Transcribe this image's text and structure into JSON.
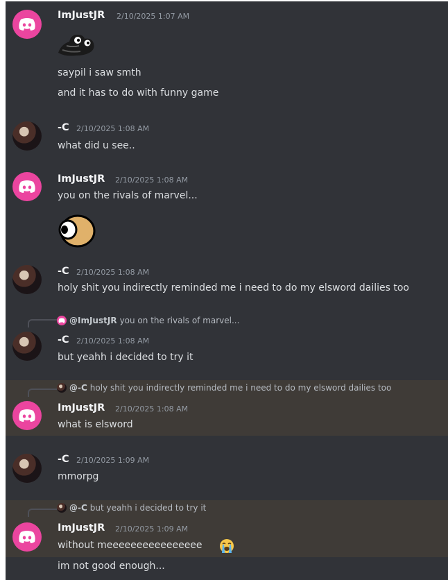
{
  "users": {
    "jr": "ImJustJR",
    "c": "-C"
  },
  "colors": {
    "background": "#313338",
    "highlight": "#3f3b37",
    "discord_pink": "#eb459f",
    "username": "#f2f3f5",
    "text": "#dbdee1",
    "timestamp": "#949ba4"
  },
  "icons": {
    "default_avatar": "discord-logo-icon",
    "character_avatar": "anime-character-avatar",
    "loud_crying_emoji": "loudly-crying-face-emoji"
  },
  "messages": [
    {
      "author": "ImJustJR",
      "timestamp": "2/10/2025 1:07 AM",
      "lines": [
        "saypil i saw smth",
        "and it has to do with funny game"
      ]
    },
    {
      "author": "-C",
      "timestamp": "2/10/2025 1:08 AM",
      "lines": [
        "what did u see.."
      ]
    },
    {
      "author": "ImJustJR",
      "timestamp": "2/10/2025 1:08 AM",
      "lines": [
        "you on the rivals of marvel..."
      ]
    },
    {
      "author": "-C",
      "timestamp": "2/10/2025 1:08 AM",
      "lines": [
        "holy shit you indirectly reminded me i need to do my elsword dailies too"
      ]
    },
    {
      "author": "-C",
      "timestamp": "2/10/2025 1:08 AM",
      "reply_to": {
        "name": "@ImJustJR",
        "text": "you on the rivals of marvel..."
      },
      "lines": [
        "but yeahh i decided to try it"
      ]
    },
    {
      "author": "ImJustJR",
      "timestamp": "2/10/2025 1:08 AM",
      "reply_to": {
        "name": "@-C",
        "text": "holy shit you indirectly reminded me i need to do my elsword dailies too"
      },
      "lines": [
        "what is elsword"
      ]
    },
    {
      "author": "-C",
      "timestamp": "2/10/2025 1:09 AM",
      "lines": [
        "mmorpg"
      ]
    },
    {
      "author": "ImJustJR",
      "timestamp": "2/10/2025 1:09 AM",
      "reply_to": {
        "name": "@-C",
        "text": "but yeahh i decided to try it"
      },
      "lines": [
        "without meeeeeeeeeeeeeeee",
        "im not good enough..."
      ]
    }
  ]
}
